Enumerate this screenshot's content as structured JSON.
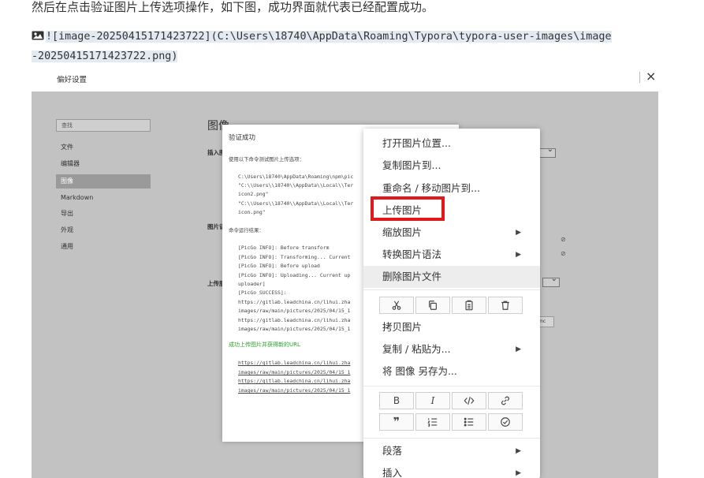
{
  "doc": {
    "line1": "然后在点击验证图片上传选项操作，如下图，成功界面就代表已经配置成功。",
    "md_line1": "![image-20250415171423722](C:\\Users\\18740\\AppData\\Roaming\\Typora\\typora-user-images\\image",
    "md_line2": "-20250415171423722.png)"
  },
  "window": {
    "title": "偏好设置",
    "close": "×"
  },
  "prefs": {
    "search_placeholder": "查找",
    "nav": [
      "文件",
      "编辑器",
      "图像",
      "Markdown",
      "导出",
      "外观",
      "通用"
    ],
    "active_nav": "图像",
    "heading": "图像",
    "label_insert": "插入图",
    "label_image": "图片语",
    "label_upload": "上传服",
    "cmd_value": "mc"
  },
  "verify": {
    "title": "验证成功",
    "intro": "使用以下命令测试图片上传选项：",
    "cmd_lines": [
      "C:\\Users\\18740\\AppData\\Roaming\\npm\\pic",
      "\"C:\\\\Users\\\\18740\\\\AppData\\\\Local\\\\Ter",
      "icon2.png\"",
      "\"C:\\\\Users\\\\18740\\\\AppData\\\\Local\\\\Ter",
      "icon.png\""
    ],
    "result_label": "命令运行结果：",
    "log_lines": [
      "[PicGo INFO]: Before transform",
      "[PicGo INFO]: Transforming... Current",
      "[PicGo INFO]: Before upload",
      "[PicGo INFO]: Uploading... Current up",
      "uploader]",
      "[PicGo SUCCESS]:",
      "https://gitlab.leadchina.cn/lihui.zha",
      "images/raw/main/pictures/2025/04/15_1",
      "https://gitlab.leadchina.cn/lihui.zha",
      "images/raw/main/pictures/2025/04/15_1"
    ],
    "success_text": "成功上传图片并获得新的URL",
    "url_lines": [
      "https://gitlab.leadchina.cn/lihui.zha",
      "images/raw/main/pictures/2025/04/15_1",
      "https://gitlab.leadchina.cn/lihui.zha",
      "images/raw/main/pictures/2025/04/15_1"
    ]
  },
  "menu": {
    "open_location": "打开图片位置...",
    "copy_to": "复制图片到...",
    "rename_move": "重命名 / 移动图片到...",
    "upload": "上传图片",
    "zoom": "缩放图片",
    "convert_syntax": "转换图片语法",
    "delete_file": "删除图片文件",
    "copy_image": "拷贝图片",
    "copy_paste_as": "复制 / 粘贴为...",
    "save_image_as": "将 图像 另存为...",
    "paragraph": "段落",
    "insert": "插入",
    "bold_glyph": "B",
    "italic_glyph": "I",
    "quote_glyph": "❞",
    "highlight_color": "#e01a1a"
  }
}
